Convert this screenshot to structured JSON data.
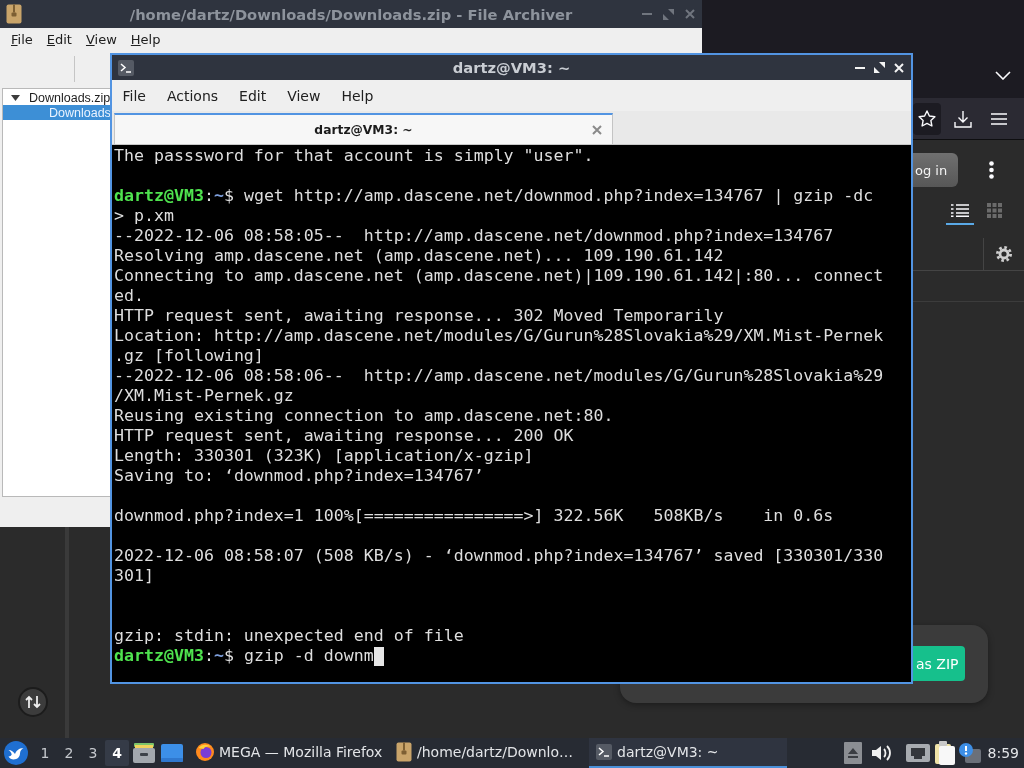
{
  "browser_window": {
    "login_button": "og in",
    "view_buttons": [
      {
        "kind": "list",
        "selected": true
      },
      {
        "kind": "grid",
        "selected": false
      }
    ],
    "dialog_button": "as ZIP"
  },
  "archiver_window": {
    "title": "/home/dartz/Downloads/Downloads.zip - File Archiver",
    "menu_mnemonics": true,
    "menu": [
      "File",
      "Edit",
      "View",
      "Help"
    ],
    "tree": [
      {
        "label": "Downloads.zip",
        "expanded": true,
        "selected": false,
        "children": [
          {
            "label": "Downloads",
            "selected": true
          }
        ]
      }
    ]
  },
  "terminal_window": {
    "title": "dartz@VM3: ~",
    "menu": [
      "File",
      "Actions",
      "Edit",
      "View",
      "Help"
    ],
    "tabs": [
      {
        "label": "dartz@VM3: ~",
        "selected": true
      }
    ],
    "cursor": true,
    "lines": [
      {
        "kind": "output",
        "text": "The passsword for that account is simply \"user\"."
      },
      {
        "kind": "blank"
      },
      {
        "kind": "prompt",
        "user": "dartz@VM3",
        "separator": ":",
        "path": "~",
        "command": "$ wget http://amp.dascene.net/downmod.php?index=134767 | gzip -dc"
      },
      {
        "kind": "output",
        "text": "> p.xm"
      },
      {
        "kind": "output",
        "text": "--2022-12-06 08:58:05--  http://amp.dascene.net/downmod.php?index=134767"
      },
      {
        "kind": "output",
        "text": "Resolving amp.dascene.net (amp.dascene.net)... 109.190.61.142"
      },
      {
        "kind": "output",
        "text": "Connecting to amp.dascene.net (amp.dascene.net)|109.190.61.142|:80... connect"
      },
      {
        "kind": "output",
        "text": "ed."
      },
      {
        "kind": "output",
        "text": "HTTP request sent, awaiting response... 302 Moved Temporarily"
      },
      {
        "kind": "output",
        "text": "Location: http://amp.dascene.net/modules/G/Gurun%28Slovakia%29/XM.Mist-Pernek"
      },
      {
        "kind": "output",
        "text": ".gz [following]"
      },
      {
        "kind": "output",
        "text": "--2022-12-06 08:58:06--  http://amp.dascene.net/modules/G/Gurun%28Slovakia%29"
      },
      {
        "kind": "output",
        "text": "/XM.Mist-Pernek.gz"
      },
      {
        "kind": "output",
        "text": "Reusing existing connection to amp.dascene.net:80."
      },
      {
        "kind": "output",
        "text": "HTTP request sent, awaiting response... 200 OK"
      },
      {
        "kind": "output",
        "text": "Length: 330301 (323K) [application/x-gzip]"
      },
      {
        "kind": "output",
        "text": "Saving to: ‘downmod.php?index=134767’"
      },
      {
        "kind": "blank"
      },
      {
        "kind": "output",
        "text": "downmod.php?index=1 100%[================>] 322.56K   508KB/s    in 0.6s"
      },
      {
        "kind": "blank"
      },
      {
        "kind": "output",
        "text": "2022-12-06 08:58:07 (508 KB/s) - ‘downmod.php?index=134767’ saved [330301/330"
      },
      {
        "kind": "output",
        "text": "301]"
      },
      {
        "kind": "blank"
      },
      {
        "kind": "blank"
      },
      {
        "kind": "output",
        "text": "gzip: stdin: unexpected end of file"
      },
      {
        "kind": "prompt",
        "user": "dartz@VM3",
        "separator": ":",
        "path": "~",
        "command": "$ gzip -d downm"
      }
    ]
  },
  "taskbar": {
    "workspaces": [
      {
        "label": "1",
        "selected": false
      },
      {
        "label": "2",
        "selected": false
      },
      {
        "label": "3",
        "selected": false
      },
      {
        "label": "4",
        "selected": true
      }
    ],
    "tasks": [
      {
        "kind": "browser",
        "label": "MEGA — Mozilla Firefox",
        "selected": false
      },
      {
        "kind": "archiver",
        "label": "/home/dartz/Downlo…",
        "selected": false
      },
      {
        "kind": "terminal",
        "label": "dartz@VM3: ~",
        "selected": true
      }
    ],
    "clock": "8:59"
  }
}
